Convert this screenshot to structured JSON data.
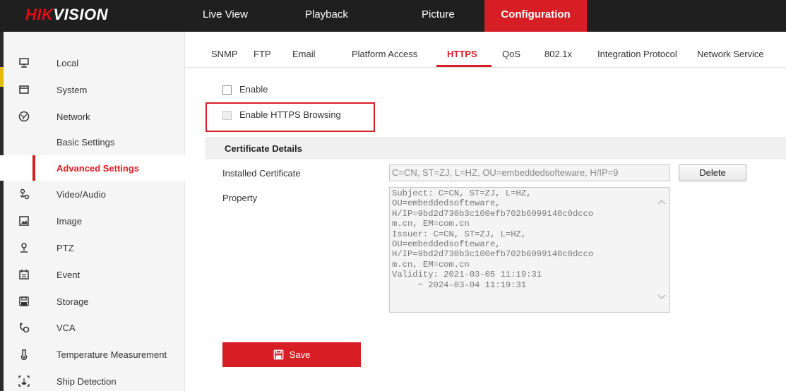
{
  "brand": {
    "logo_red": "HIK",
    "logo_white": "VISION"
  },
  "nav": [
    "Live View",
    "Playback",
    "Picture",
    "Configuration"
  ],
  "sidebar": {
    "items": [
      {
        "label": "Local",
        "icon": "monitor-icon"
      },
      {
        "label": "System",
        "icon": "system-icon"
      },
      {
        "label": "Network",
        "icon": "network-icon"
      },
      {
        "label": "Basic Settings"
      },
      {
        "label": "Advanced Settings"
      },
      {
        "label": "Video/Audio",
        "icon": "video-audio-icon"
      },
      {
        "label": "Image",
        "icon": "image-icon"
      },
      {
        "label": "PTZ",
        "icon": "ptz-icon"
      },
      {
        "label": "Event",
        "icon": "event-icon"
      },
      {
        "label": "Storage",
        "icon": "storage-icon"
      },
      {
        "label": "VCA",
        "icon": "vca-icon"
      },
      {
        "label": "Temperature Measurement",
        "icon": "thermometer-icon"
      },
      {
        "label": "Ship Detection",
        "icon": "ship-detection-icon"
      }
    ]
  },
  "tabs": [
    "SNMP",
    "FTP",
    "Email",
    "Platform Access",
    "HTTPS",
    "QoS",
    "802.1x",
    "Integration Protocol",
    "Network Service"
  ],
  "https": {
    "enable_label": "Enable",
    "enable_browsing_label": "Enable HTTPS Browsing",
    "section_title": "Certificate Details",
    "installed_label": "Installed Certificate",
    "installed_value": "C=CN, ST=ZJ, L=HZ, OU=embeddedsofteware, H/IP=9",
    "delete_label": "Delete",
    "property_label": "Property",
    "property_text": "Subject: C=CN, ST=ZJ, L=HZ,\nOU=embeddedsofteware,\nH/IP=9bd2d730b3c100efb702b6099140c0dcco\nm.cn, EM=com.cn\nIssuer: C=CN, ST=ZJ, L=HZ,\nOU=embeddedsofteware,\nH/IP=9bd2d730b3c100efb702b6099140c0dcco\nm.cn, EM=com.cn\nValidity: 2021-03-05 11:19:31\n     ~ 2024-03-04 11:19:31",
    "save_label": "Save"
  },
  "colors": {
    "accent": "#d81e25",
    "topbar": "#1f1f1f",
    "sidebar_bg": "#f5f5f5"
  }
}
